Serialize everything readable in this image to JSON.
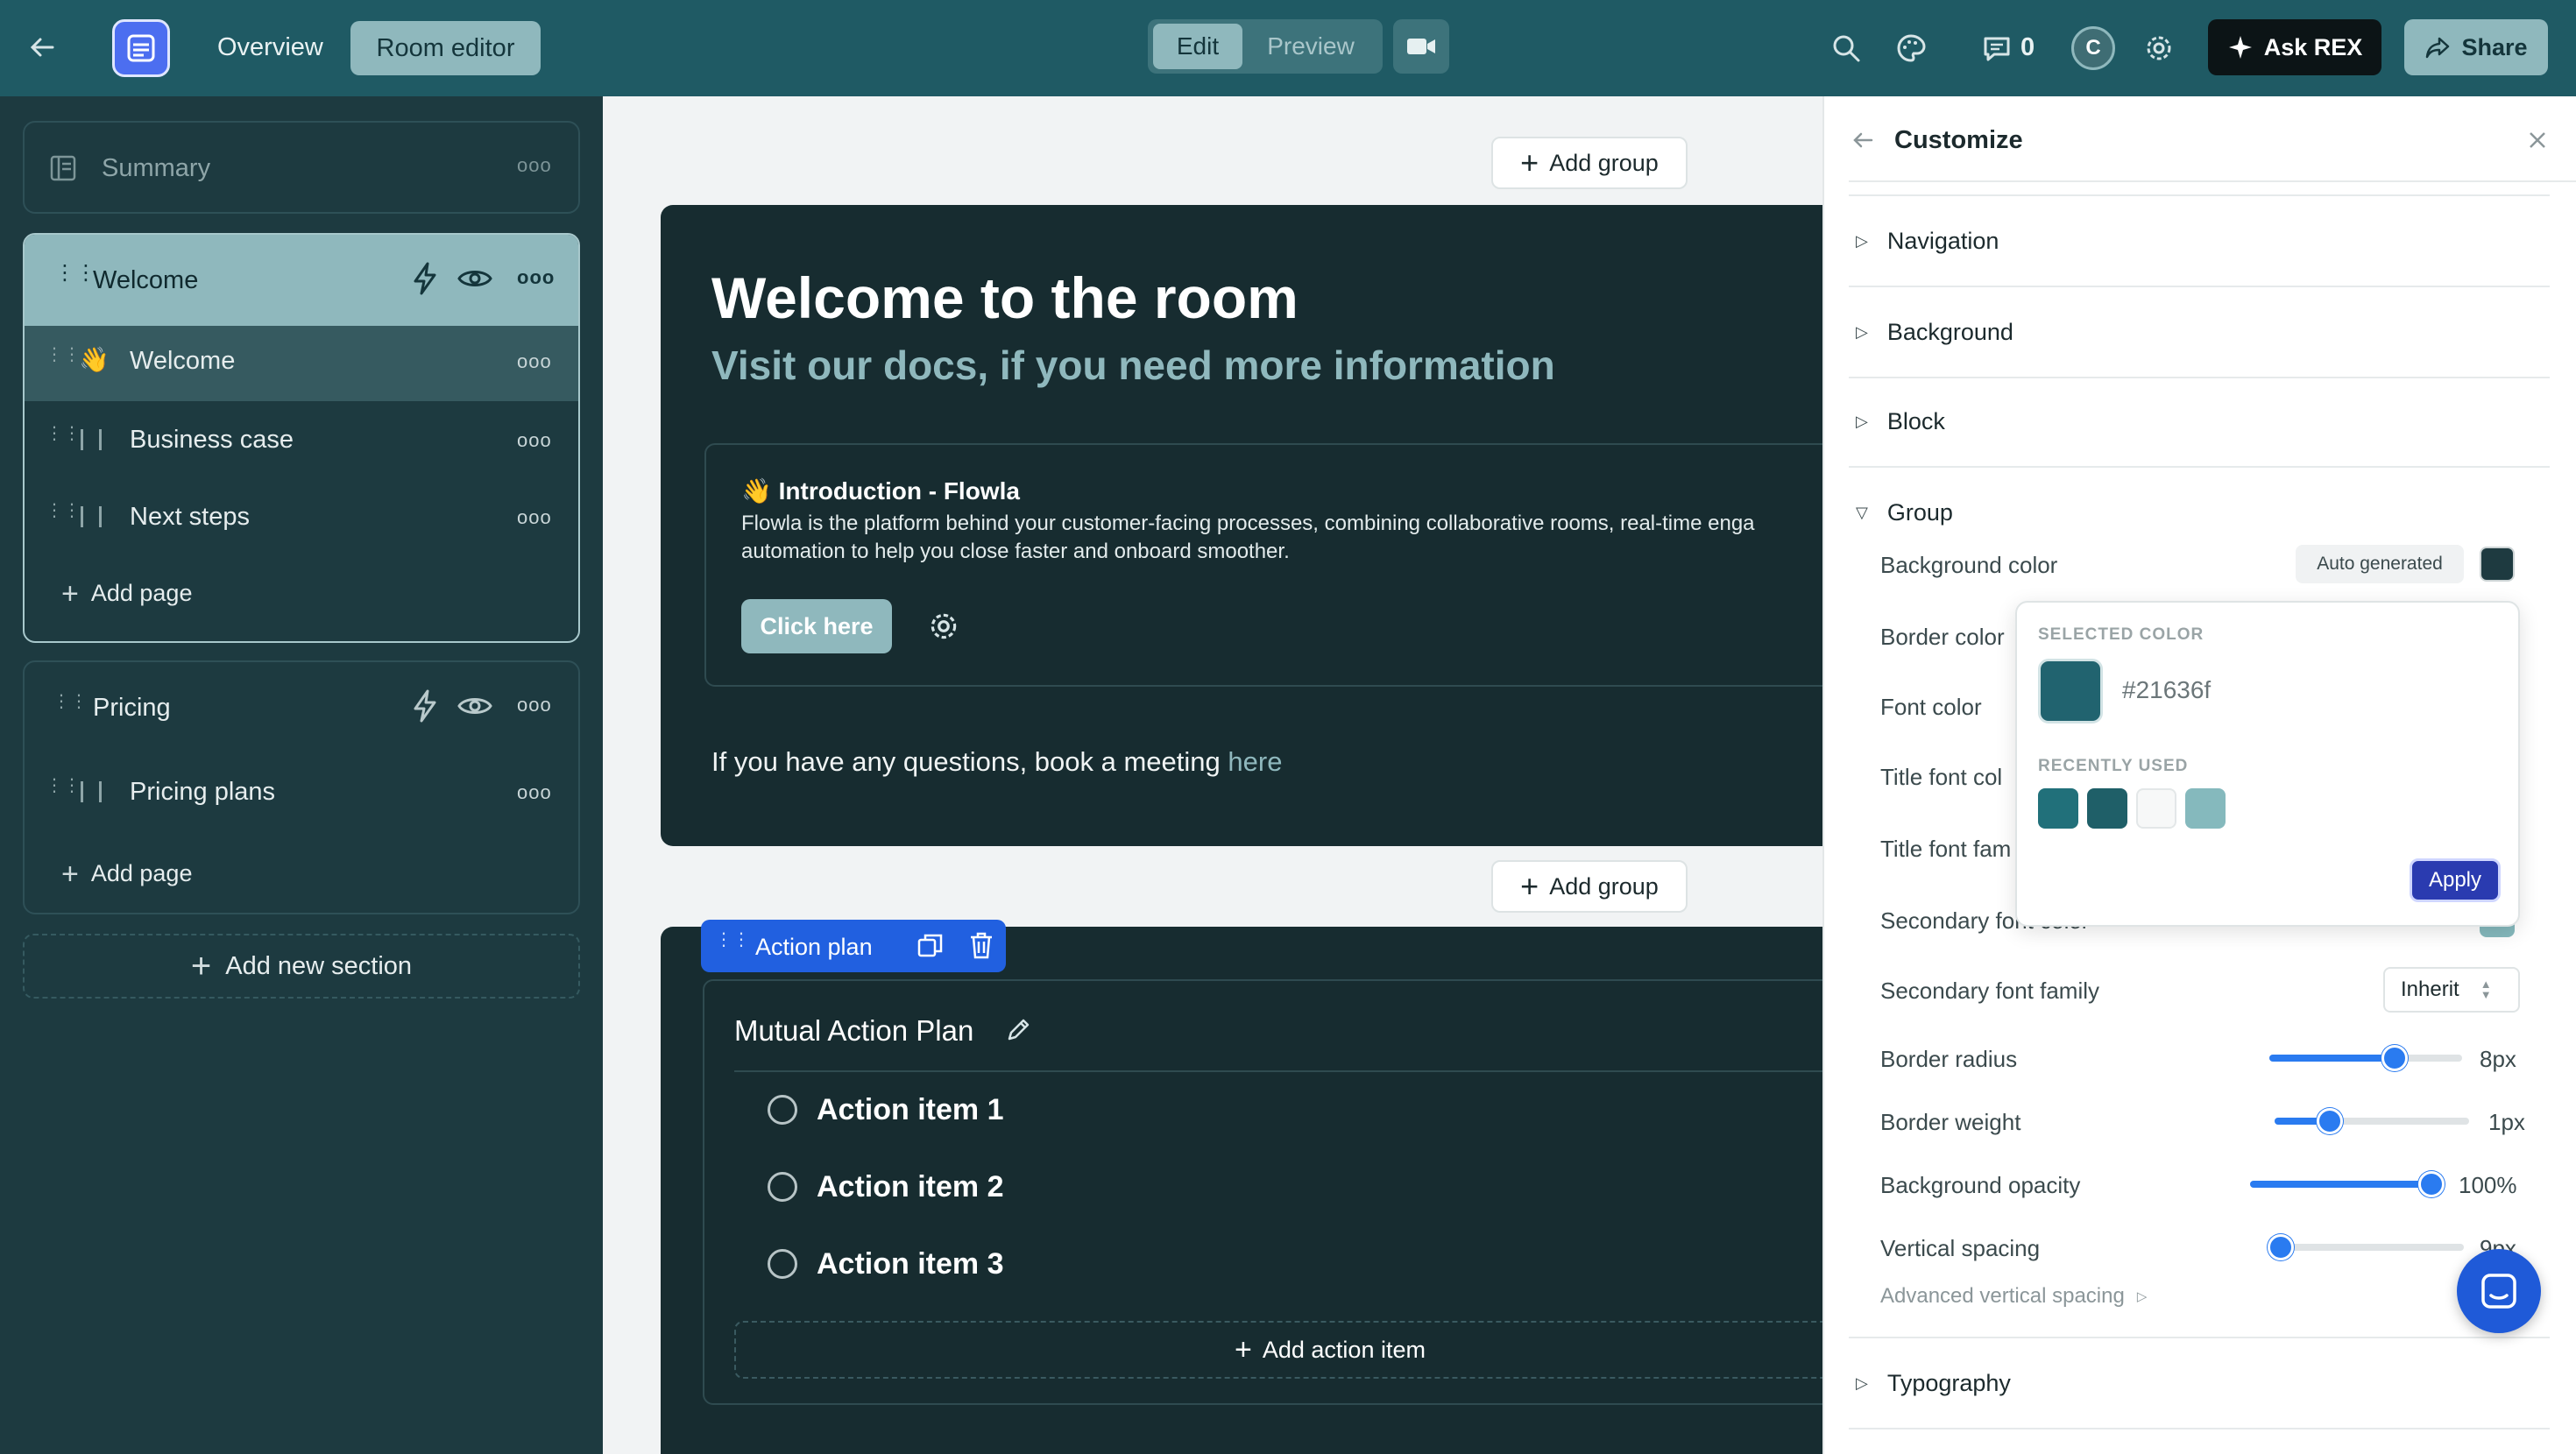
{
  "topbar": {
    "tabs": {
      "overview": "Overview",
      "room_editor": "Room editor"
    },
    "mode": {
      "edit": "Edit",
      "preview": "Preview"
    },
    "comments_count": "0",
    "avatar_initial": "C",
    "ask_rex": "Ask REX",
    "share": "Share"
  },
  "sidebar": {
    "summary": "Summary",
    "section_welcome": "Welcome",
    "pages_welcome": [
      {
        "emoji": "👋",
        "label": "Welcome"
      },
      {
        "label": "Business case"
      },
      {
        "label": "Next steps"
      }
    ],
    "add_page": "Add page",
    "section_pricing": "Pricing",
    "pages_pricing": [
      {
        "label": "Pricing plans"
      }
    ],
    "add_page_2": "Add page",
    "add_section": "Add new section"
  },
  "canvas": {
    "add_group": "Add group",
    "add_group_2": "Add group",
    "welcome_title": "Welcome to the room",
    "welcome_subtitle": "Visit our docs, if you need more information",
    "intro_title": "👋 Introduction - Flowla",
    "intro_body_1": "Flowla is the platform behind your customer-facing processes, combining collaborative rooms, real-time enga",
    "intro_body_2": "automation to help you close faster and onboard smoother.",
    "intro_button": "Click here",
    "questions_text": "If you have any questions, book a meeting ",
    "questions_link": "here",
    "action_tag": "Action plan",
    "map_title": "Mutual Action Plan",
    "action_items": [
      "Action item 1",
      "Action item 2",
      "Action item 3"
    ],
    "add_action_item": "Add action item"
  },
  "panel": {
    "title": "Customize",
    "sections": {
      "navigation": "Navigation",
      "background": "Background",
      "block": "Block",
      "group": "Group",
      "typography": "Typography"
    },
    "background_color": "Background color",
    "auto_generated": "Auto generated",
    "border_color": "Border color",
    "font_color": "Font color",
    "title_font_color": "Title font col",
    "title_font_family": "Title font fam",
    "secondary_font_color": "Secondary font color",
    "secondary_font_family": "Secondary font family",
    "inherit": "Inherit",
    "border_radius": {
      "label": "Border radius",
      "value": "8px",
      "level": 0.65
    },
    "border_weight": {
      "label": "Border weight",
      "value": "1px",
      "level": 0.28
    },
    "background_opacity": {
      "label": "Background opacity",
      "value": "100%",
      "level": 1.0
    },
    "vertical_spacing": {
      "label": "Vertical spacing",
      "value": "9px",
      "level": 0.0
    },
    "advanced_spacing": "Advanced vertical spacing"
  },
  "color_picker": {
    "selected_label": "SELECTED COLOR",
    "selected_hex": "#21636f",
    "recent_label": "RECENTLY USED",
    "recent": [
      "#21707a",
      "#1f5f68",
      "#f7f8f8",
      "#85b9bd"
    ],
    "apply": "Apply"
  },
  "colors": {
    "topbar": "#1f5a64",
    "sidebar": "#1d3a40",
    "block": "#172c30",
    "accent": "#2a7bf0",
    "swatch_group_bg": "#1e3a40"
  }
}
